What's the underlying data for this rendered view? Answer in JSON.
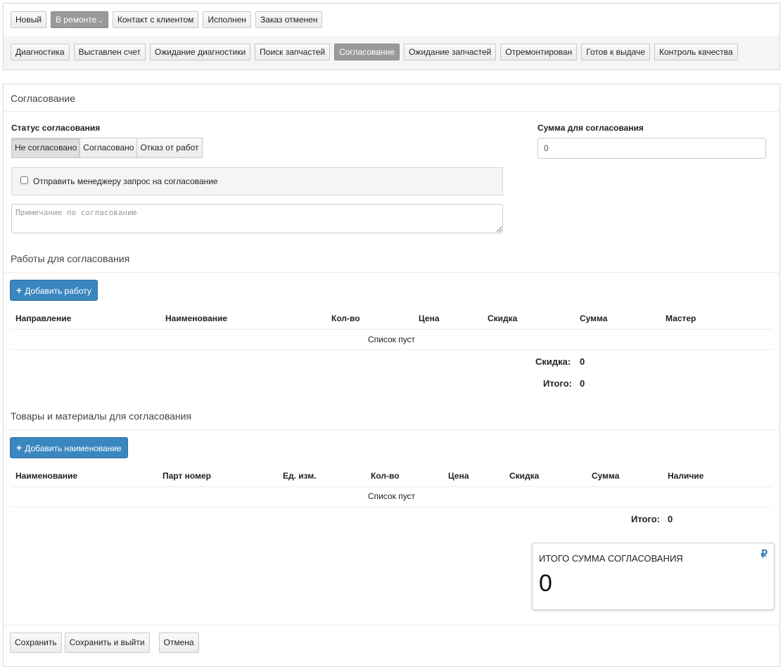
{
  "status_bar": {
    "primary": [
      {
        "label": "Новый",
        "active": false
      },
      {
        "label": "В ремонте",
        "active": true,
        "dropdown": true
      },
      {
        "label": "Контакт с клиентом",
        "active": false
      },
      {
        "label": "Исполнен",
        "active": false
      },
      {
        "label": "Заказ отменен",
        "active": false
      }
    ],
    "secondary": [
      {
        "label": "Диагностика",
        "active": false
      },
      {
        "label": "Выставлен счет",
        "active": false
      },
      {
        "label": "Ожидание диагностики",
        "active": false
      },
      {
        "label": "Поиск запчастей",
        "active": false
      },
      {
        "label": "Согласование",
        "active": true
      },
      {
        "label": "Ожидание запчастей",
        "active": false
      },
      {
        "label": "Отремонтирован",
        "active": false
      },
      {
        "label": "Готов к выдаче",
        "active": false
      },
      {
        "label": "Контроль качества",
        "active": false
      }
    ],
    "dropdown_caret": "⌄"
  },
  "form": {
    "title": "Согласование",
    "approval_status_label": "Статус согласования",
    "approval_status_options": [
      "Не согласовано",
      "Согласовано",
      "Отказ от работ"
    ],
    "approval_status_selected": "Не согласовано",
    "sum_label": "Сумма для согласования",
    "sum_value": "0",
    "send_request_label": "Отправить менеджеру запрос на согласование",
    "send_request_checked": false,
    "note_placeholder": "Примечание по согласованию"
  },
  "works": {
    "title": "Работы для согласования",
    "add_button": "Добавить работу",
    "columns": [
      "Направление",
      "Наименование",
      "Кол-во",
      "Цена",
      "Скидка",
      "Сумма",
      "Мастер"
    ],
    "empty_text": "Список пуст",
    "discount_label": "Скидка:",
    "discount_value": "0",
    "total_label": "Итого:",
    "total_value": "0"
  },
  "goods": {
    "title": "Товары и материалы для согласования",
    "add_button": "Добавить наименование",
    "columns": [
      "Наименование",
      "Парт номер",
      "Ед. изм.",
      "Кол-во",
      "Цена",
      "Скидка",
      "Сумма",
      "Наличие"
    ],
    "empty_text": "Список пуст",
    "total_label": "Итого:",
    "total_value": "0"
  },
  "summary_card": {
    "title": "ИТОГО СУММА СОГЛАСОВАНИЯ",
    "value": "0",
    "currency_icon": "ruble-icon",
    "currency_symbol": "₽",
    "accent_color": "#2a7ab8"
  },
  "footer": {
    "save": "Сохранить",
    "save_exit": "Сохранить и выйти",
    "cancel": "Отмена"
  },
  "colors": {
    "active_status": "#9a9a9a",
    "primary_button": "#3a87c0"
  }
}
